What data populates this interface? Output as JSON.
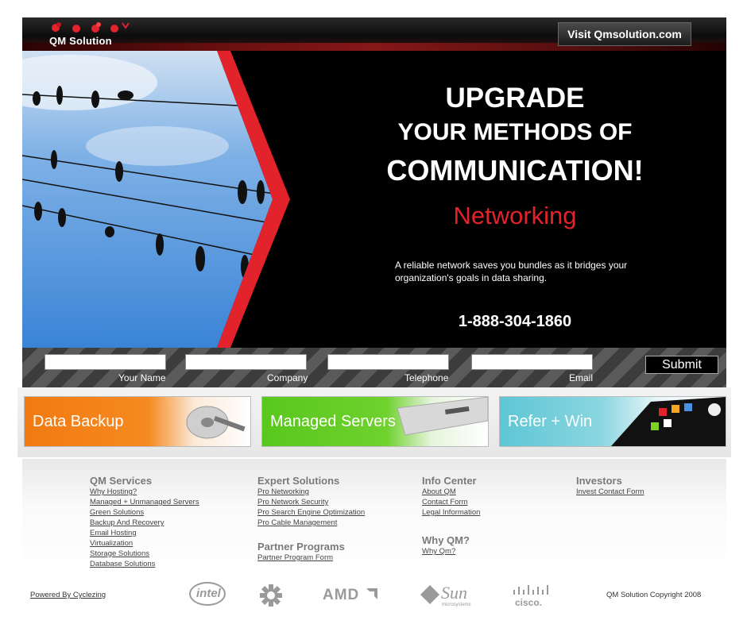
{
  "header": {
    "logo_text": "QM Solution",
    "visit_button": "Visit Qmsolution.com"
  },
  "hero": {
    "line1": "UPGRADE",
    "line2": "YOUR METHODS OF",
    "line3": "COMMUNICATION!",
    "highlight": "Networking",
    "description": "A reliable network saves you bundles as it bridges your organization's goals in data sharing.",
    "phone": "1-888-304-1860"
  },
  "form": {
    "name_label": "Your Name",
    "company_label": "Company",
    "telephone_label": "Telephone",
    "email_label": "Email",
    "submit_label": "Submit"
  },
  "banners": {
    "backup": "Data Backup",
    "servers": "Managed Servers",
    "refer": "Refer + Win"
  },
  "footer": {
    "services_title": "QM Services",
    "services_links": [
      "Why Hosting?",
      "Managed + Unmanaged Servers",
      "Green Solutions",
      "Backup And Recovery",
      "Email Hosting",
      "Virtualization",
      "Storage Solutions",
      "Database Solutions"
    ],
    "expert_title": "Expert Solutions",
    "expert_links": [
      "Pro Networking",
      "Pro Network Security",
      "Pro Search Engine Optimization",
      "Pro Cable Management"
    ],
    "partner_title": "Partner Programs",
    "partner_links": [
      "Partner Program Form"
    ],
    "info_title": "Info Center",
    "info_links": [
      "About QM",
      "Contact Form",
      "Legal Information"
    ],
    "whyqm_title": "Why QM?",
    "whyqm_links": [
      "Why Qm?"
    ],
    "investors_title": "Investors",
    "investors_links": [
      "Invest Contact Form"
    ]
  },
  "bottom": {
    "powered_by": "Powered By Cyclezing",
    "copyright": "QM Solution Copyright 2008",
    "partners": {
      "intel": "intel",
      "amd": "AMD",
      "sun": "Sun",
      "sun_sub": "microsystems",
      "cisco": "cisco."
    }
  },
  "colors": {
    "accent_red": "#e3232b",
    "backup_orange": "#f27a12",
    "servers_green": "#58c81c",
    "refer_teal": "#5ec6d4"
  }
}
